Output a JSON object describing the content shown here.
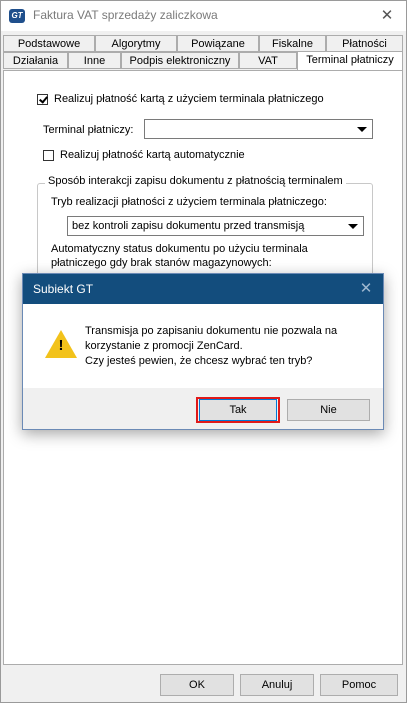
{
  "window": {
    "title": "Faktura VAT sprzedaży zaliczkowa",
    "app_icon_text": "GT"
  },
  "tabs": {
    "row1": [
      "Podstawowe",
      "Algorytmy",
      "Powiązane",
      "Fiskalne",
      "Płatności"
    ],
    "row2": [
      "Działania",
      "Inne",
      "Podpis elektroniczny",
      "VAT",
      "Terminal płatniczy"
    ],
    "active": "Terminal płatniczy"
  },
  "form": {
    "use_terminal_label": "Realizuj płatność kartą z użyciem terminala płatniczego",
    "use_terminal_checked": true,
    "terminal_label": "Terminal płatniczy:",
    "terminal_value": "",
    "auto_label": "Realizuj płatność kartą automatycznie",
    "auto_checked": false,
    "group_title": "Sposób interakcji zapisu dokumentu z płatnością terminalem",
    "mode_label": "Tryb realizacji płatności z użyciem terminala płatniczego:",
    "mode_value": "bez kontroli zapisu dokumentu przed transmisją",
    "auto_status_label_1": "Automatyczny status dokumentu po użyciu terminala",
    "auto_status_label_2": "płatniczego gdy brak stanów magazynowych:"
  },
  "dialog": {
    "title": "Subiekt GT",
    "message_1": "Transmisja po zapisaniu dokumentu nie pozwala na",
    "message_2": "korzystanie z promocji ZenCard.",
    "message_3": "Czy jesteś pewien, że chcesz wybrać ten tryb?",
    "yes_label": "Tak",
    "no_label": "Nie",
    "icon": "warning-icon"
  },
  "footer": {
    "ok_label": "OK",
    "cancel_label": "Anuluj",
    "help_label": "Pomoc"
  },
  "colors": {
    "dialog_title_bg": "#134d7d",
    "highlight": "#e01a1a",
    "warning": "#f2c21b"
  }
}
